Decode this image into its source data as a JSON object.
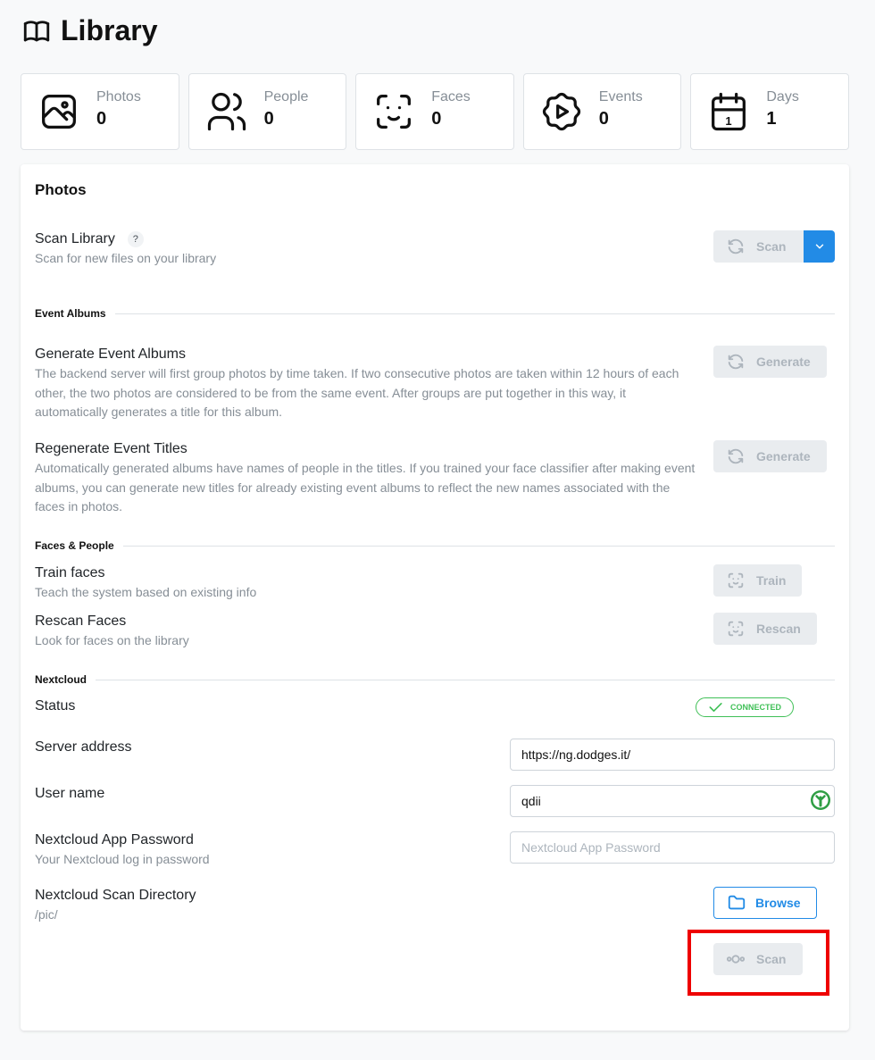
{
  "page": {
    "title": "Library"
  },
  "stats": [
    {
      "label": "Photos",
      "value": "0",
      "icon": "photo-icon"
    },
    {
      "label": "People",
      "value": "0",
      "icon": "users-icon"
    },
    {
      "label": "Faces",
      "value": "0",
      "icon": "face-id-icon"
    },
    {
      "label": "Events",
      "value": "0",
      "icon": "rosette-play-icon"
    },
    {
      "label": "Days",
      "value": "1",
      "icon": "calendar-icon"
    }
  ],
  "calendar_icon_day": "1",
  "card": {
    "title": "Photos",
    "scan_library": {
      "title": "Scan Library",
      "help": "?",
      "desc": "Scan for new files on your library",
      "button": "Scan"
    },
    "event_albums": {
      "header": "Event Albums",
      "generate": {
        "title": "Generate Event Albums",
        "desc": "The backend server will first group photos by time taken. If two consecutive photos are taken within 12 hours of each other, the two photos are considered to be from the same event. After groups are put together in this way, it automatically generates a title for this album.",
        "button": "Generate"
      },
      "regenerate": {
        "title": "Regenerate Event Titles",
        "desc": "Automatically generated albums have names of people in the titles. If you trained your face classifier after making event albums, you can generate new titles for already existing event albums to reflect the new names associated with the faces in photos.",
        "button": "Generate"
      }
    },
    "faces_people": {
      "header": "Faces & People",
      "train": {
        "title": "Train faces",
        "desc": "Teach the system based on existing info",
        "button": "Train"
      },
      "rescan": {
        "title": "Rescan Faces",
        "desc": "Look for faces on the library",
        "button": "Rescan"
      }
    },
    "nextcloud": {
      "header": "Nextcloud",
      "status": {
        "title": "Status",
        "badge": "CONNECTED"
      },
      "server": {
        "title": "Server address",
        "value": "https://ng.dodges.it/"
      },
      "user": {
        "title": "User name",
        "value": "qdii"
      },
      "password": {
        "title": "Nextcloud App Password",
        "desc": "Your Nextcloud log in password",
        "placeholder": "Nextcloud App Password"
      },
      "directory": {
        "title": "Nextcloud Scan Directory",
        "desc": "/pic/",
        "browse_button": "Browse"
      },
      "scan_button": "Scan"
    }
  },
  "colors": {
    "primary": "#228be6",
    "success": "#40c057",
    "disabled_bg": "#e9ecef",
    "disabled_text": "#adb5bd",
    "highlight": "#ee0000"
  }
}
